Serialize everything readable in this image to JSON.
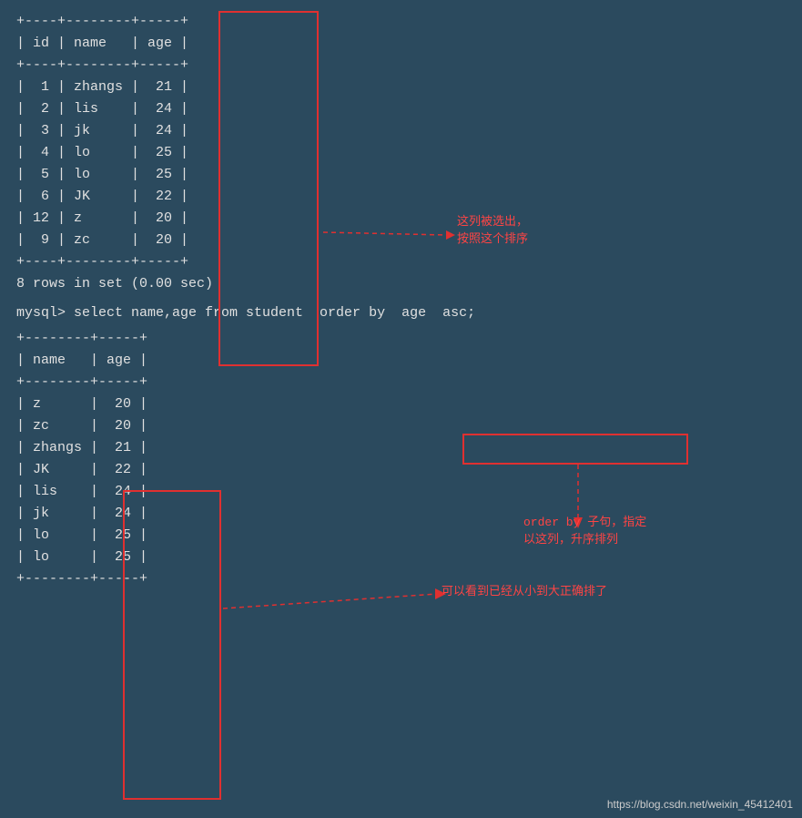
{
  "background": "#2b4a5e",
  "top_table": {
    "separator_top": "+----+--------+-----+",
    "header": "| id | name   | age |",
    "separator_mid": "+----+--------+-----+",
    "rows": [
      "|  1 | zhangs |  21 |",
      "|  2 | lis    |  24 |",
      "|  3 | jk     |  24 |",
      "|  4 | lo     |  25 |",
      "|  5 | lo     |  25 |",
      "|  6 | JK     |  22 |",
      "| 12 | z      |  20 |",
      "|  9 | zc     |  20 |"
    ],
    "separator_bot": "+----+--------+-----+",
    "result_line": "8 rows in set (0.00 sec)"
  },
  "sql_command": "mysql> select name,age from student  order by  age  asc;",
  "bottom_table": {
    "separator_top": "+--------+-----+",
    "header": "| name   | age |",
    "separator_mid": "+--------+-----+",
    "rows": [
      "| z      |  20 |",
      "| zc     |  20 |",
      "| zhangs |  21 |",
      "| JK     |  22 |",
      "| lis    |  24 |",
      "| jk     |  24 |",
      "| lo     |  25 |",
      "| lo     |  25 |"
    ],
    "separator_bot": "+--------+-----+"
  },
  "annotations": {
    "top_right": "这列被选出，\n按照这个排序",
    "middle_right": "order by 子句，指定\n以这列，升序排列",
    "bottom_right": "可以看到已经从小到大正确排了"
  },
  "watermark": "https://blog.csdn.net/weixin_45412401"
}
